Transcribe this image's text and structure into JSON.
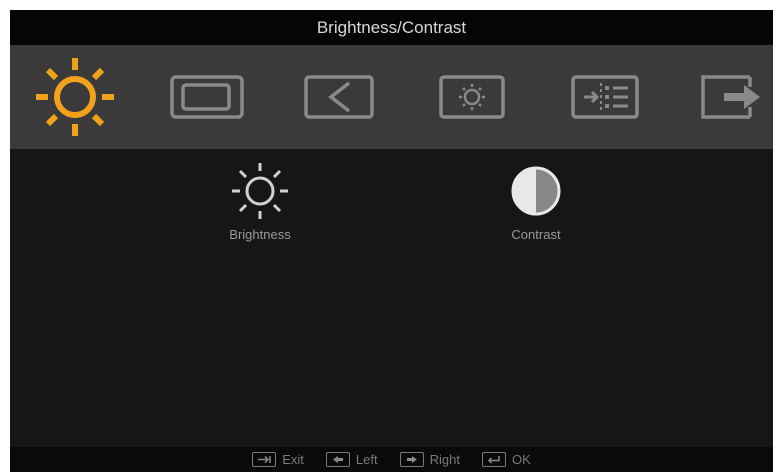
{
  "window": {
    "title": "Brightness/Contrast"
  },
  "tabs": [
    {
      "icon": "brightness-sun-icon",
      "active": true
    },
    {
      "icon": "image-setup-icon",
      "active": false
    },
    {
      "icon": "image-properties-icon",
      "active": false
    },
    {
      "icon": "options-icon",
      "active": false
    },
    {
      "icon": "advanced-settings-icon",
      "active": false
    },
    {
      "icon": "exit-icon",
      "active": false
    }
  ],
  "items": [
    {
      "icon": "sun-icon",
      "label": "Brightness"
    },
    {
      "icon": "contrast-icon",
      "label": "Contrast"
    }
  ],
  "footer": {
    "exit": "Exit",
    "left": "Left",
    "right": "Right",
    "ok": "OK"
  },
  "colors": {
    "accent": "#f2a21a",
    "icon_inactive": "#8a8a8a",
    "text": "#9a9a9a"
  }
}
